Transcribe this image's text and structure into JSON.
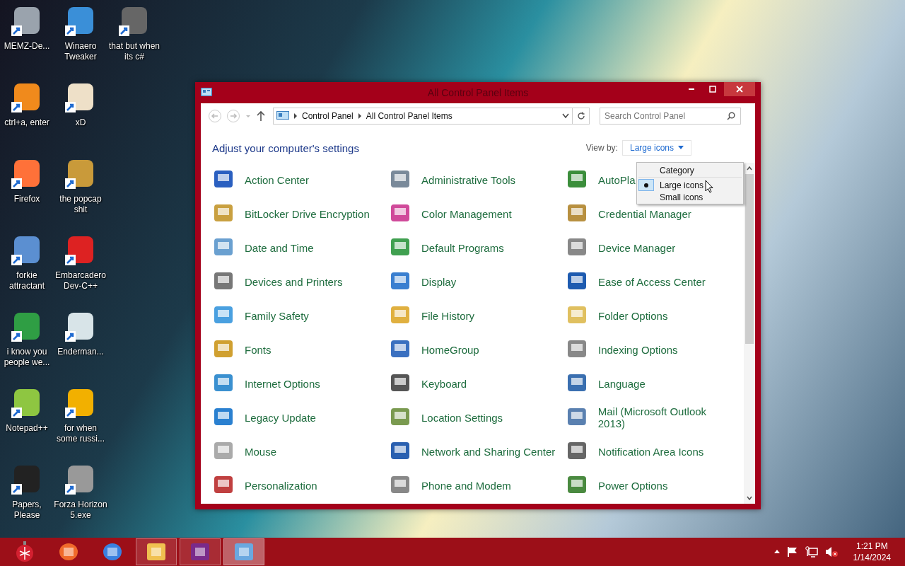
{
  "desktop": {
    "icons": [
      {
        "label": "MEMZ-De..."
      },
      {
        "label": "ctrl+a, enter"
      },
      {
        "label": "Firefox"
      },
      {
        "label": "forkie attractant"
      },
      {
        "label": "i know you people we..."
      },
      {
        "label": "Notepad++"
      },
      {
        "label": "Papers, Please"
      },
      {
        "label": "Winaero Tweaker"
      },
      {
        "label": "xD"
      },
      {
        "label": "the popcap shit"
      },
      {
        "label": "Embarcadero Dev-C++"
      },
      {
        "label": "Enderman..."
      },
      {
        "label": "for when some russi..."
      },
      {
        "label": "Forza Horizon 5.exe"
      },
      {
        "label": "that but when its c#"
      }
    ]
  },
  "window": {
    "title": "All Control Panel Items",
    "breadcrumb": [
      "Control Panel",
      "All Control Panel Items"
    ],
    "search": {
      "placeholder": "Search Control Panel"
    },
    "heading": "Adjust your computer's settings",
    "view_by": {
      "label": "View by:",
      "value": "Large icons"
    },
    "view_menu": [
      {
        "label": "Category",
        "selected": false
      },
      {
        "label": "Large icons",
        "selected": true
      },
      {
        "label": "Small icons",
        "selected": false
      }
    ],
    "items": [
      "Action Center",
      "Administrative Tools",
      "AutoPla",
      "BitLocker Drive Encryption",
      "Color Management",
      "Credential Manager",
      "Date and Time",
      "Default Programs",
      "Device Manager",
      "Devices and Printers",
      "Display",
      "Ease of Access Center",
      "Family Safety",
      "File History",
      "Folder Options",
      "Fonts",
      "HomeGroup",
      "Indexing Options",
      "Internet Options",
      "Keyboard",
      "Language",
      "Legacy Update",
      "Location Settings",
      "Mail (Microsoft Outlook 2013)",
      "Mouse",
      "Network and Sharing Center",
      "Notification Area Icons",
      "Personalization",
      "Phone and Modem",
      "Power Options"
    ]
  },
  "taskbar": {
    "apps": [
      {
        "running": false,
        "selected": false
      },
      {
        "running": false,
        "selected": false
      },
      {
        "running": true,
        "selected": false
      },
      {
        "running": true,
        "selected": false
      },
      {
        "running": true,
        "selected": true
      }
    ],
    "clock": {
      "time": "1:21 PM",
      "date": "1/14/2024"
    }
  }
}
